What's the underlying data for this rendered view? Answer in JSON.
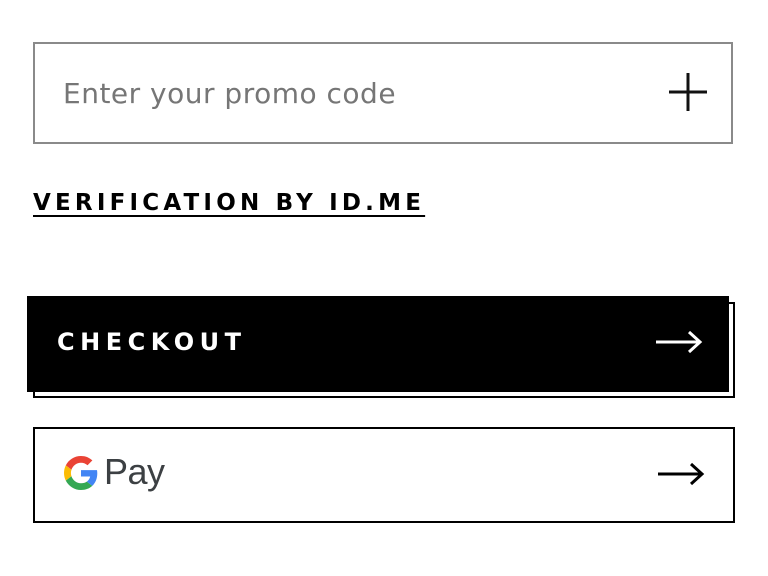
{
  "promo": {
    "placeholder": "Enter your promo code",
    "value": "",
    "add_icon": "plus-icon"
  },
  "verification": {
    "label": "VERIFICATION BY ID.ME"
  },
  "checkout": {
    "label": "CHECKOUT",
    "icon": "arrow-right-icon",
    "background": "#000000",
    "text_color": "#ffffff"
  },
  "gpay": {
    "brand_letter": "G",
    "label": "Pay",
    "icon": "arrow-right-icon",
    "brand_colors": [
      "#4285F4",
      "#EA4335",
      "#FBBC05",
      "#34A853"
    ]
  }
}
